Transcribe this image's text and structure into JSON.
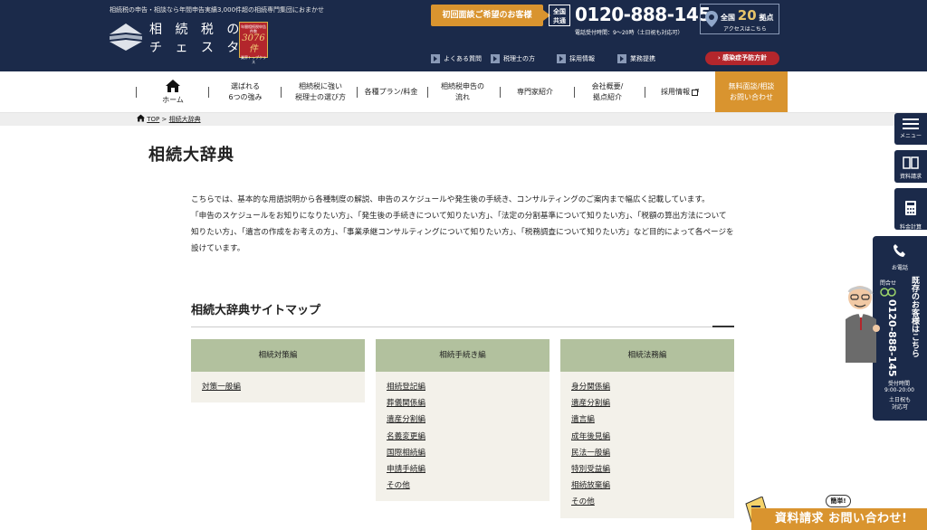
{
  "header": {
    "tagline": "相続税の申告・相談なら年間申告実績3,000件超の相続専門集団におまかせ",
    "logo_line1": "相 続 税 の",
    "logo_line2": "チ ェ ス タ ー",
    "badge_top": "年間相続税申告件数",
    "badge_num": "3076件",
    "badge_bottom": "業界トップクラス",
    "cta_label": "初回面談ご希望のお客様",
    "zenkoku": "全国\n共通",
    "phone": "0120-888-145",
    "phone_hours": "電話受付時間：9〜20時（土日祝も対応可）",
    "location_prefix": "全国",
    "location_count": "20",
    "location_suffix": "拠点",
    "location_sub": "アクセスはこちら",
    "sublinks": [
      "よくある質問",
      "税理士の方",
      "採用情報",
      "業務提携"
    ],
    "infection_label": "感染症予防方針"
  },
  "nav": {
    "home": "ホーム",
    "items": [
      "選ばれる\n6つの強み",
      "相続税に強い\n税理士の選び方",
      "各種プラン/料金",
      "相続税申告の\n流れ",
      "専門家紹介",
      "会社概要/\n拠点紹介",
      "採用情報"
    ],
    "contact": "無料面談/相談\nお問い合わせ"
  },
  "breadcrumb": {
    "home": "TOP",
    "sep": ">",
    "current": "相続大辞典"
  },
  "page_title": "相続大辞典",
  "intro": {
    "p1": "こちらでは、基本的な用語説明から各種制度の解説、申告のスケジュールや発生後の手続き、コンサルティングのご案内まで幅広く記載しています。",
    "p2": "「申告のスケジュールをお知りになりたい方」、「発生後の手続きについて知りたい方」、「法定の分割基準について知りたい方」、「税額の算出方法について知りたい方」、「遺言の作成をお考えの方」、「事業承継コンサルティングについて知りたい方」、「税務調査について知りたい方」など目的によって各ページを設けています。"
  },
  "sitemap": {
    "title": "相続大辞典サイトマップ",
    "columns": [
      {
        "heading": "相続対策編",
        "links": [
          "対策一般編"
        ]
      },
      {
        "heading": "相続手続き編",
        "links": [
          "相続登記編",
          "葬儀関係編",
          "遺産分割編",
          "名義変更編",
          "国際相続編",
          "申請手続編",
          "その他"
        ]
      },
      {
        "heading": "相続法務編",
        "links": [
          "身分関係編",
          "遺産分割編",
          "遺言編",
          "成年後見編",
          "民法一般編",
          "特別受益編",
          "相続放棄編",
          "その他"
        ]
      }
    ]
  },
  "side": {
    "menu": "メニュー",
    "docs": "資料請求",
    "calc": "料金計算\nツール",
    "phone_label": "お電話",
    "existing_label": "問合せ",
    "existing_vertical": "既存のお客様はこちら",
    "phone_vertical": "0120-888-145",
    "hours_label": "受付時間",
    "hours": "9:00-20:00",
    "weekend": "土日祝も\n対応可"
  },
  "banner": {
    "bubble": "簡単!",
    "text": "資料請求  お問い合わせ!"
  },
  "colors": {
    "navy": "#1b2a4a",
    "orange": "#d9942f",
    "olive": "#b2c19e",
    "red": "#b3262c",
    "cream": "#f3f1ea"
  }
}
